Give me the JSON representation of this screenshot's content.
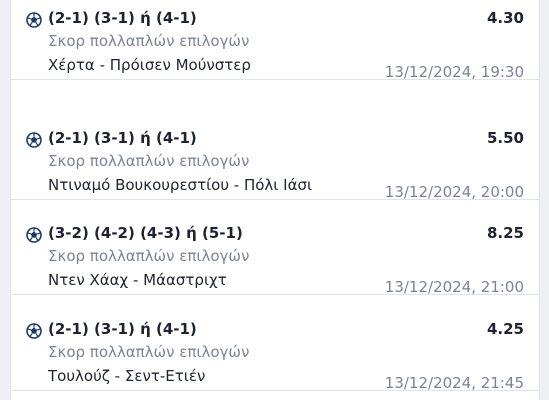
{
  "bets": [
    {
      "icon": "football-icon",
      "selection": "(2-1) (3-1) ή (4-1)",
      "market": "Σκορ πολλαπλών επιλογών",
      "event": "Χέρτα - Πρόισεν Μούνστερ",
      "odds": "4.30",
      "datetime": "13/12/2024, 19:30"
    },
    {
      "icon": "football-icon",
      "selection": "(2-1) (3-1) ή (4-1)",
      "market": "Σκορ πολλαπλών επιλογών",
      "event": "Ντιναμό Βουκουρεστίου - Πόλι Ιάσι",
      "odds": "5.50",
      "datetime": "13/12/2024, 20:00"
    },
    {
      "icon": "football-icon",
      "selection": "(3-2) (4-2) (4-3) ή (5-1)",
      "market": "Σκορ πολλαπλών επιλογών",
      "event": "Ντεν Χάαχ - Μάαστριχτ",
      "odds": "8.25",
      "datetime": "13/12/2024, 21:00"
    },
    {
      "icon": "football-icon",
      "selection": "(2-1) (3-1) ή (4-1)",
      "market": "Σκορ πολλαπλών επιλογών",
      "event": "Τουλούζ - Σεντ-Ετιέν",
      "odds": "4.25",
      "datetime": "13/12/2024, 21:45"
    }
  ]
}
